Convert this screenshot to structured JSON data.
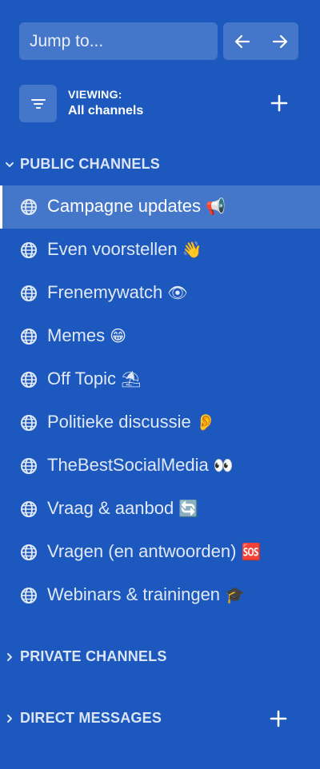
{
  "search": {
    "placeholder": "Jump to..."
  },
  "nav": {
    "back_icon": "arrow-left-icon",
    "forward_icon": "arrow-right-icon"
  },
  "viewing": {
    "label": "VIEWING:",
    "value": "All channels",
    "filter_icon": "filter-icon",
    "add_icon": "plus-icon"
  },
  "sections": {
    "public": {
      "title": "PUBLIC CHANNELS",
      "expanded": true
    },
    "private": {
      "title": "PRIVATE CHANNELS",
      "expanded": false
    },
    "direct": {
      "title": "DIRECT MESSAGES",
      "expanded": false
    }
  },
  "channels": [
    {
      "name": "Campagne updates",
      "emoji": "📢",
      "active": true
    },
    {
      "name": "Even voorstellen",
      "emoji": "👋",
      "active": false
    },
    {
      "name": "Frenemywatch",
      "emoji": "👁",
      "active": false
    },
    {
      "name": "Memes",
      "emoji": "😁",
      "active": false
    },
    {
      "name": "Off Topic",
      "emoji": "⛱",
      "active": false
    },
    {
      "name": "Politieke discussie",
      "emoji": "👂",
      "active": false
    },
    {
      "name": "TheBestSocialMedia",
      "emoji": "👀",
      "active": false
    },
    {
      "name": "Vraag & aanbod",
      "emoji": "🔄",
      "active": false
    },
    {
      "name": "Vragen (en antwoorden)",
      "emoji": "🆘",
      "active": false
    },
    {
      "name": "Webinars & trainingen",
      "emoji": "🎓",
      "active": false
    }
  ],
  "colors": {
    "background": "#1c58bd",
    "active_row": "#3e70c5",
    "text": "#ffffff"
  }
}
